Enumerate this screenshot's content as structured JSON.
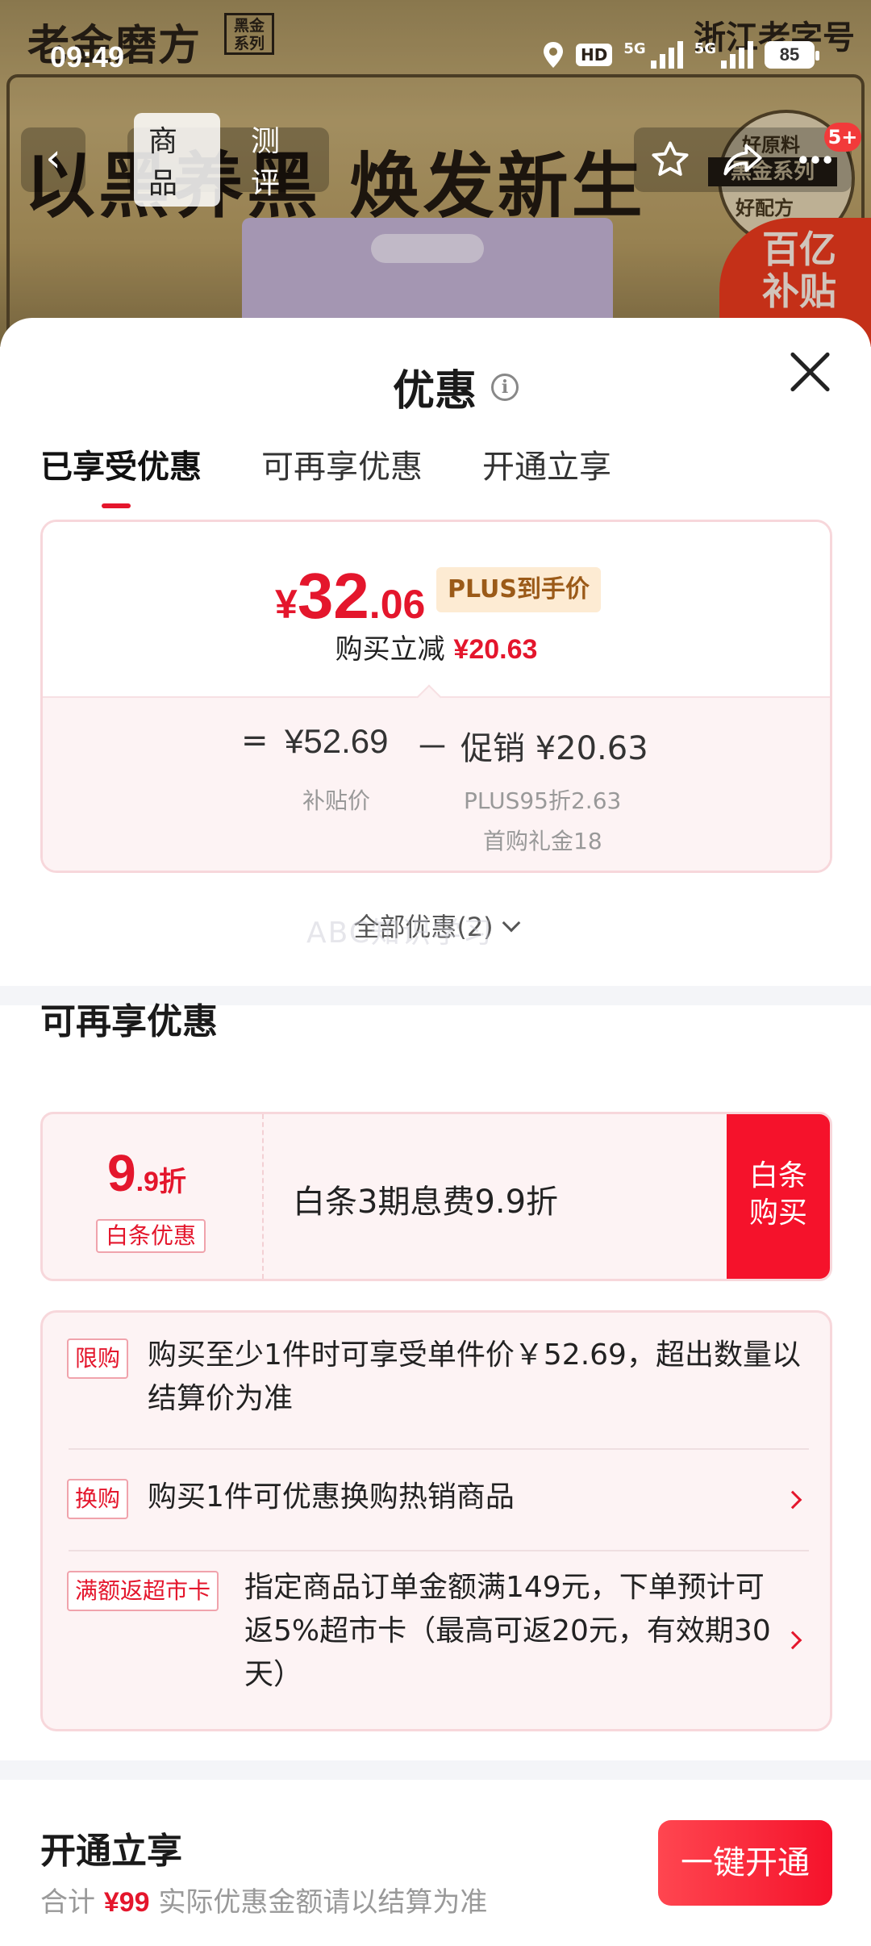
{
  "status_bar": {
    "time": "09:49",
    "hd": "HD",
    "net_a": "5G",
    "net_b": "5G",
    "battery": "85"
  },
  "product_bg": {
    "brand": "老金磨方",
    "brand_tag": "黑金系列",
    "brand_cn": "浙江老字号",
    "slogan": "以黑养黑 焕发新生",
    "seal_top": "好原料",
    "seal_mid": "黑金系列",
    "seal_bottom": "好配方",
    "subsidy": "百亿补贴"
  },
  "product_nav": {
    "back": "‹",
    "tabs": [
      "商品",
      "测评"
    ],
    "active_tab": 0,
    "badge": "5+"
  },
  "sheet": {
    "title": "优惠",
    "tabs": [
      "已享受优惠",
      "可再享优惠",
      "开通立享"
    ],
    "active_tab": 0,
    "price": {
      "symbol": "¥",
      "int": "32",
      "dec": ".06",
      "plus_tag": "PLUS到手价",
      "instant_label": "购买立减",
      "instant_value": "¥20.63"
    },
    "calc": {
      "eq": "=",
      "subsidy_price": "¥52.69",
      "minus": "－",
      "promo": "促销 ¥20.63",
      "subsidy_label": "补贴价",
      "promo_line1": "PLUS95折2.63",
      "promo_line2": "首购礼金18"
    },
    "all_promo": "全部优惠(2)",
    "watermark": "ABC知识学习",
    "section2": {
      "title": "可再享优惠",
      "baitiao": {
        "rate_big": "9",
        "rate_small": ".9折",
        "tag": "白条优惠",
        "desc": "白条3期息费9.9折",
        "btn_line1": "白条",
        "btn_line2": "购买"
      },
      "rules": [
        {
          "tag": "限购",
          "text_l1": "购买至少1件时可享受单件价￥52.69，超出数量以",
          "text_l2": "结算价为准"
        },
        {
          "tag": "换购",
          "text_l1": "购买1件可优惠换购热销商品"
        },
        {
          "tag": "满额返超市卡",
          "text_l1": "指定商品订单金额满149元，下单预计可",
          "text_l2": "返5%超市卡（最高可返20元，有效期30",
          "text_l3": "天）"
        }
      ]
    },
    "section3": {
      "title": "开通立享",
      "total_label": "合计",
      "total_value": "¥99",
      "total_note": "实际优惠金额请以结算为准",
      "button": "一键开通"
    }
  },
  "colors": {
    "accent_red": "#e4162c",
    "button_red": "#f5122b",
    "plus_tag_bg": "#fdebd3",
    "card_pink": "#fdf3f4"
  }
}
